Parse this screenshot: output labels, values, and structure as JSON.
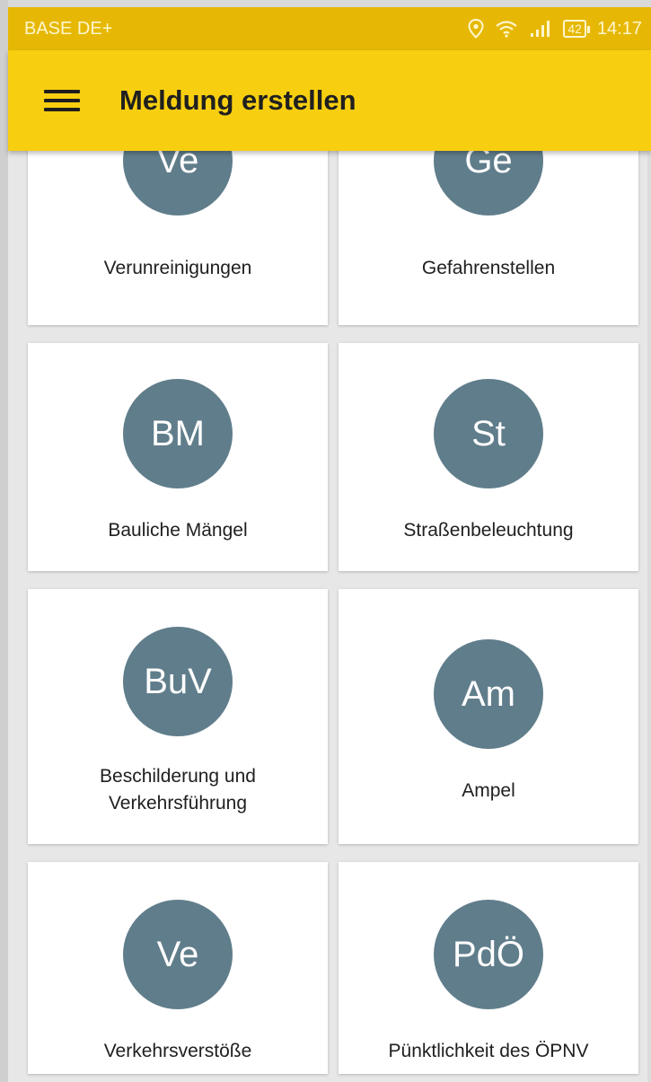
{
  "status_bar": {
    "carrier": "BASE DE+",
    "battery": "42",
    "time": "14:17",
    "icons": [
      "location-icon",
      "wifi-icon",
      "signal-icon",
      "battery-icon"
    ]
  },
  "toolbar": {
    "title": "Meldung erstellen",
    "menu_icon": "hamburger-menu-icon",
    "background_color": "#f8cf10"
  },
  "colors": {
    "status_bar": "#e6b805",
    "circle": "#607d8b",
    "card": "#ffffff",
    "background": "#e7e7e7"
  },
  "categories": [
    {
      "abbr": "Ve",
      "label": "Verunreinigungen"
    },
    {
      "abbr": "Ge",
      "label": "Gefahrenstellen"
    },
    {
      "abbr": "BM",
      "label": "Bauliche Mängel"
    },
    {
      "abbr": "St",
      "label": "Straßenbeleuchtung"
    },
    {
      "abbr": "BuV",
      "label_line1": "Beschilderung und",
      "label_line2": "Verkehrsführung"
    },
    {
      "abbr": "Am",
      "label": "Ampel"
    },
    {
      "abbr": "Ve",
      "label": "Verkehrsverstöße"
    },
    {
      "abbr": "PdÖ",
      "label": "Pünktlichkeit des ÖPNV"
    }
  ]
}
